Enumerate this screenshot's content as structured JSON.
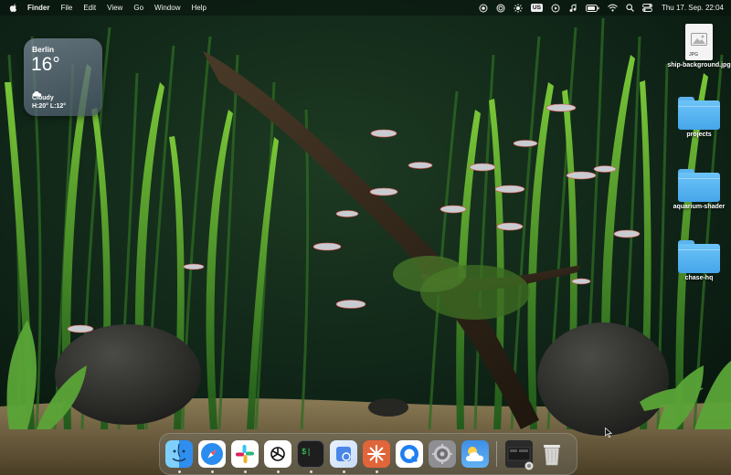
{
  "menubar": {
    "app_name": "Finder",
    "menus": [
      "File",
      "Edit",
      "View",
      "Go",
      "Window",
      "Help"
    ],
    "status_icons": [
      "screen-record-icon",
      "focus-icon",
      "brightness-icon",
      "keyboard-layout-badge",
      "media-icon",
      "music-icon",
      "battery-icon",
      "wifi-icon",
      "spotlight-icon",
      "control-center-icon"
    ],
    "keyboard_layout": "US",
    "clock": "Thu 17. Sep. 22:04"
  },
  "weather_widget": {
    "city": "Berlin",
    "temperature": "16°",
    "condition": "Cloudy",
    "high_low": "H:20° L:12°",
    "icon": "cloud-icon"
  },
  "desktop_icons": [
    {
      "label": "ship-background.jpg",
      "kind": "image-file",
      "ext": "JPG"
    },
    {
      "label": "projects",
      "kind": "folder"
    },
    {
      "label": "aquarium-shader",
      "kind": "folder"
    },
    {
      "label": "chase-hq",
      "kind": "folder"
    }
  ],
  "dock": {
    "apps": [
      "Finder",
      "Safari",
      "Slack",
      "ChatGPT",
      "Terminal",
      "Preview",
      "Claude",
      "QuickTime",
      "System Settings",
      "Weather"
    ],
    "recent": [
      "Window Preview"
    ],
    "trash": "Trash"
  },
  "colors": {
    "folder_blue": "#5db3ee",
    "menubar_bg": "#08120c",
    "water_dark": "#0f2418",
    "plant_green": "#3e8c2a"
  }
}
